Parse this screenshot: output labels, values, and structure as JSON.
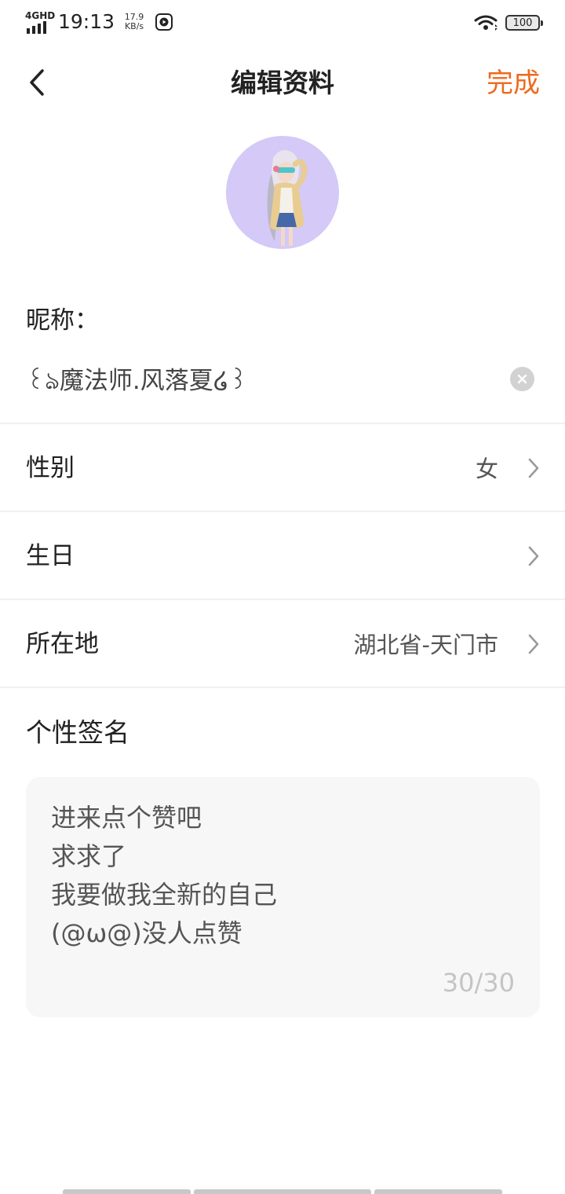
{
  "status_bar": {
    "network": "4GHD",
    "time": "19:13",
    "speed_value": "17.9",
    "speed_unit": "KB/s",
    "battery": "100"
  },
  "header": {
    "title": "编辑资料",
    "done_label": "完成"
  },
  "profile": {
    "nickname_label": "昵称：",
    "nickname_value": "꒰ঌ魔法师.风落夏໒꒱",
    "fields": [
      {
        "label": "性别",
        "value": "女"
      },
      {
        "label": "生日",
        "value": ""
      },
      {
        "label": "所在地",
        "value": "湖北省-天门市"
      }
    ],
    "signature_label": "个性签名",
    "signature_lines": [
      "进来点个赞吧",
      "求求了",
      "我要做我全新的自己",
      "(@ω@)没人点赞"
    ],
    "signature_count": "30/30"
  },
  "colors": {
    "accent": "#ee6a1e",
    "avatar_bg": "#d4c9f7",
    "signature_bg": "#f7f7f7"
  }
}
